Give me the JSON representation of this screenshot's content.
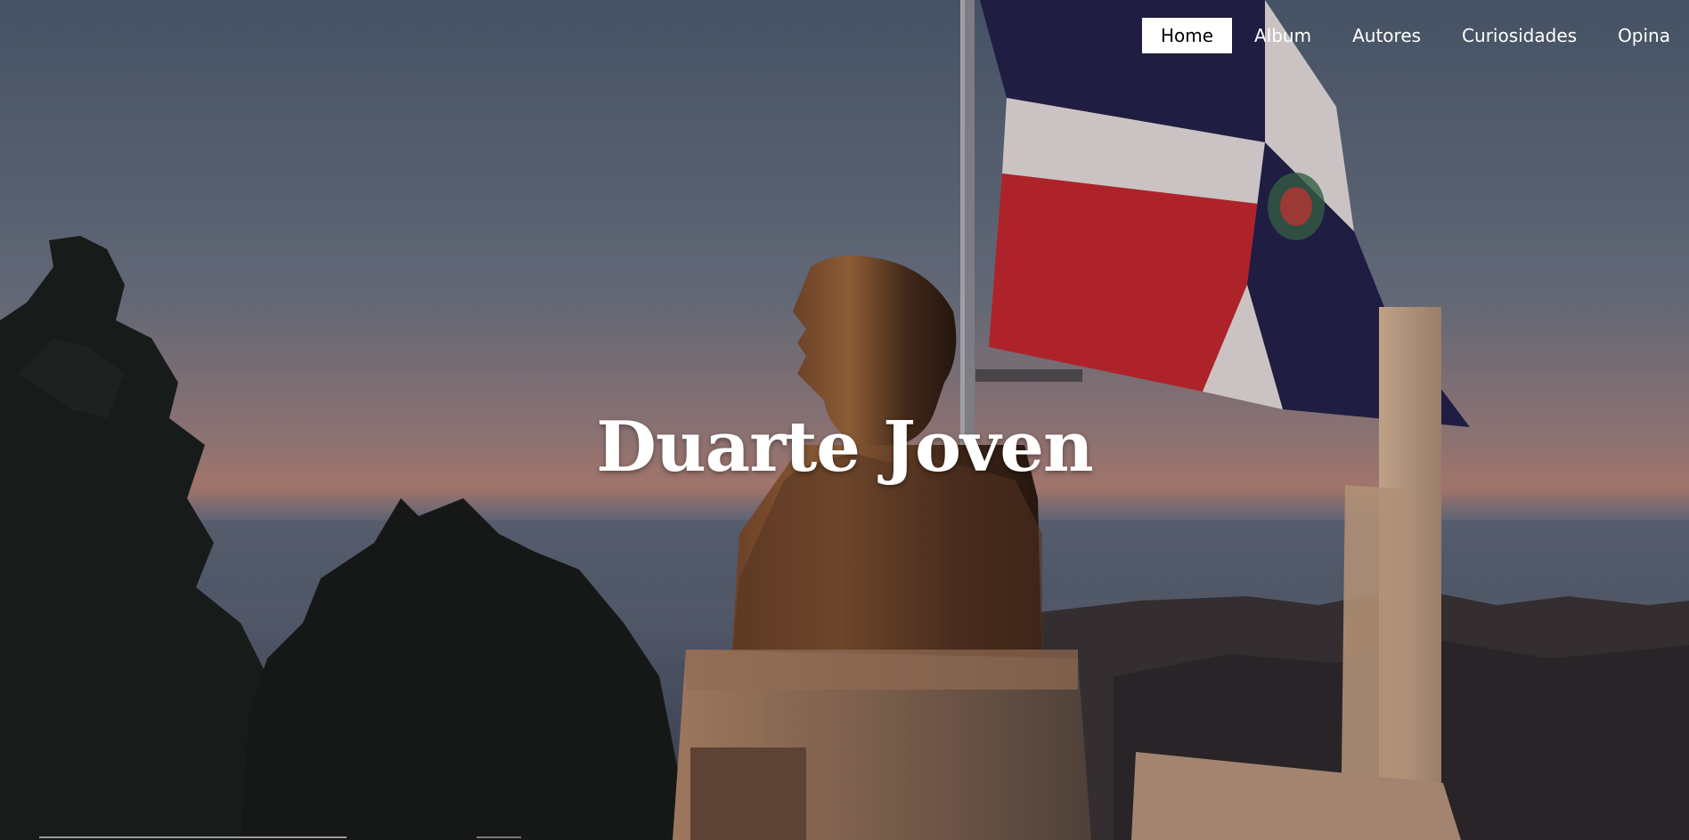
{
  "nav": {
    "items": [
      {
        "label": "Home",
        "active": true
      },
      {
        "label": "Album"
      },
      {
        "label": "Autores"
      },
      {
        "label": "Curiosidades"
      },
      {
        "label": "Opina"
      }
    ]
  },
  "hero": {
    "title": "Duarte Joven",
    "image": "duarte-bust-monument-dominican-flag-mountain-sunset"
  },
  "colors": {
    "nav_active_bg": "#ffffff",
    "nav_text": "#ffffff",
    "flag_blue": "#1e1c4a",
    "flag_red": "#c0262e"
  }
}
